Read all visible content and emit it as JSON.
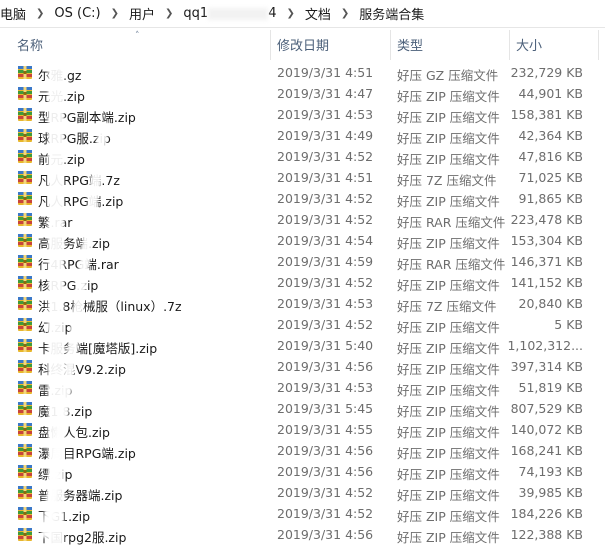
{
  "breadcrumb": {
    "items": [
      "电脑",
      "OS (C:)",
      "用户",
      "qq1",
      "4",
      "文档",
      "服务端合集"
    ]
  },
  "columns": {
    "name": "名称",
    "modified": "修改日期",
    "type": "类型",
    "size": "大小"
  },
  "files": [
    {
      "name": "尔雅.gz",
      "date": "2019/3/31 4:51",
      "type": "好压 GZ 压缩文件",
      "size": "232,729 KB"
    },
    {
      "name": "元光.zip",
      "date": "2019/3/31 4:47",
      "type": "好压 ZIP 压缩文件",
      "size": "44,901 KB"
    },
    {
      "name": "型RPG副本端.zip",
      "date": "2019/3/31 4:53",
      "type": "好压 ZIP 压缩文件",
      "size": "158,381 KB"
    },
    {
      "name": "球RPG服.zip",
      "date": "2019/3/31 4:49",
      "type": "好压 ZIP 压缩文件",
      "size": "42,364 KB"
    },
    {
      "name": "前元.zip",
      "date": "2019/3/31 4:52",
      "type": "好压 ZIP 压缩文件",
      "size": "47,816 KB"
    },
    {
      "name": "凡人RPG端.7z",
      "date": "2019/3/31 4:51",
      "type": "好压 7Z 压缩文件",
      "size": "71,025 KB"
    },
    {
      "name": "凡人RPG端.zip",
      "date": "2019/3/31 4:52",
      "type": "好压 ZIP 压缩文件",
      "size": "91,865 KB"
    },
    {
      "name": "繁.rar",
      "date": "2019/3/31 4:52",
      "type": "好压 RAR 压缩文件",
      "size": "223,478 KB"
    },
    {
      "name": "高服务端.zip",
      "date": "2019/3/31 4:54",
      "type": "好压 ZIP 压缩文件",
      "size": "153,304 KB"
    },
    {
      "name": "行4RPG端.rar",
      "date": "2019/3/31 4:59",
      "type": "好压 RAR 压缩文件",
      "size": "146,371 KB"
    },
    {
      "name": "核RPG.zip",
      "date": "2019/3/31 4:52",
      "type": "好压 ZIP 压缩文件",
      "size": "141,152 KB"
    },
    {
      "name": "洪1.8枪械服（linux）.7z",
      "date": "2019/3/31 4:53",
      "type": "好压 7Z 压缩文件",
      "size": "20,840 KB"
    },
    {
      "name": "幻.zip",
      "date": "2019/3/31 4:52",
      "type": "好压 ZIP 压缩文件",
      "size": "5 KB"
    },
    {
      "name": "卡服务端[魔塔版].zip",
      "date": "2019/3/31 5:40",
      "type": "好压 ZIP 压缩文件",
      "size": "1,102,312..."
    },
    {
      "name": "科终混V9.2.zip",
      "date": "2019/3/31 4:56",
      "type": "好压 ZIP 压缩文件",
      "size": "397,314 KB"
    },
    {
      "name": "雷.zip",
      "date": "2019/3/31 4:53",
      "type": "好压 ZIP 压缩文件",
      "size": "51,819 KB"
    },
    {
      "name": "魔1.8.zip",
      "date": "2019/3/31 5:45",
      "type": "好压 ZIP 压缩文件",
      "size": "807,529 KB"
    },
    {
      "name": "盘懒人包.zip",
      "date": "2019/3/31 4:55",
      "type": "好压 ZIP 压缩文件",
      "size": "140,072 KB"
    },
    {
      "name": "瀑周目RPG端.zip",
      "date": "2019/3/31 4:56",
      "type": "好压 ZIP 压缩文件",
      "size": "168,241 KB"
    },
    {
      "name": "缥.zip",
      "date": "2019/3/31 4:56",
      "type": "好压 ZIP 压缩文件",
      "size": "74,193 KB"
    },
    {
      "name": "普服务器端.zip",
      "date": "2019/3/31 4:52",
      "type": "好压 ZIP 压缩文件",
      "size": "39,985 KB"
    },
    {
      "name": "下G1.zip",
      "date": "2019/3/31 4:52",
      "type": "好压 ZIP 压缩文件",
      "size": "184,226 KB"
    },
    {
      "name": "下国rpg2服.zip",
      "date": "2019/3/31 4:56",
      "type": "好压 ZIP 压缩文件",
      "size": "122,388 KB"
    }
  ],
  "colors": {
    "header_text": "#4c607a",
    "meta_text": "#6d6d6d",
    "icon_blue": "#3a78c8",
    "icon_green": "#3f9a3a",
    "icon_red": "#c8453a",
    "icon_yellow": "#e8b62c"
  },
  "icons": {
    "file": "archive-icon"
  }
}
